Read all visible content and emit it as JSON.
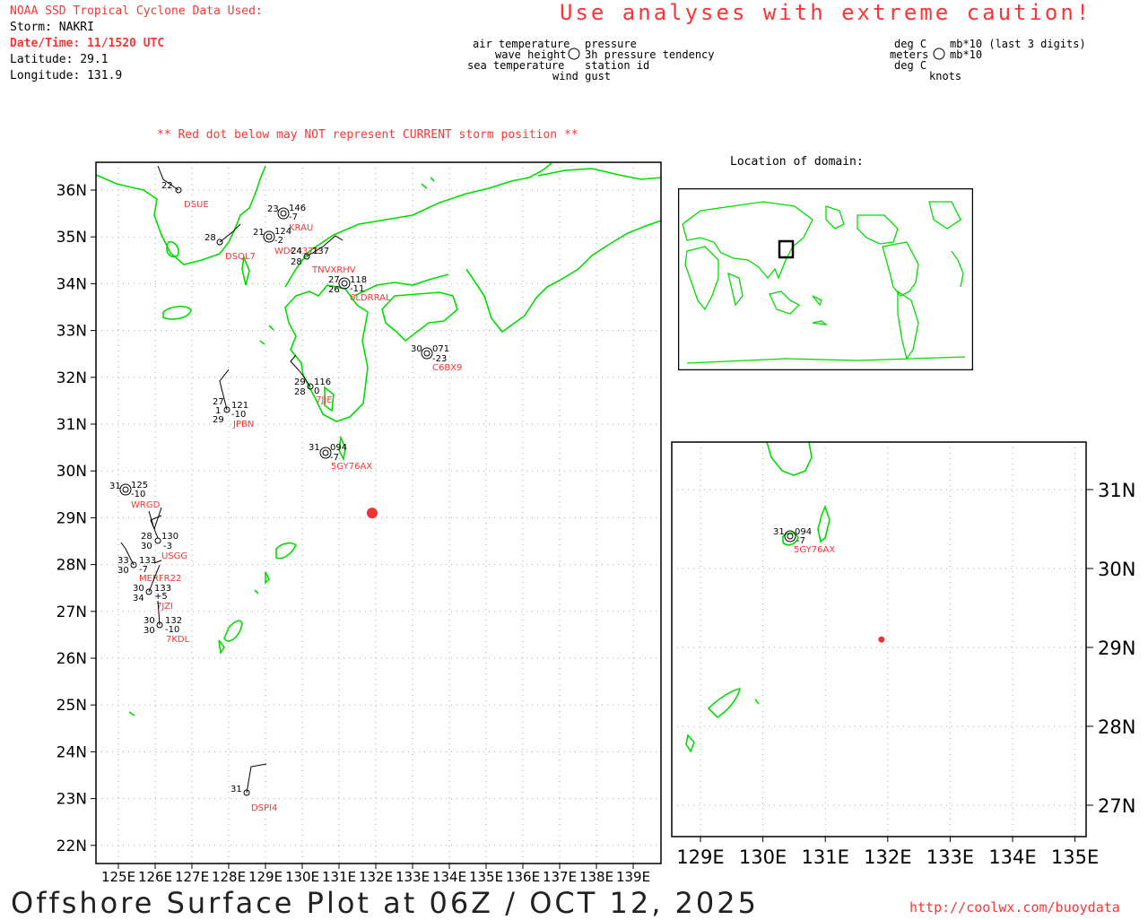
{
  "header": {
    "source_title": "NOAA SSD Tropical Cyclone Data Used:",
    "storm": "Storm: NAKRI",
    "datetime": "Date/Time: 11/1520 UTC",
    "latitude": "Latitude: 29.1",
    "longitude": "Longitude: 131.9"
  },
  "caution": "Use analyses with extreme caution!",
  "legend": {
    "left": {
      "air_temperature": "air temperature",
      "pressure": "pressure",
      "wave_height": "wave height",
      "pressure_tendency": "3h pressure tendency",
      "sea_temperature": "sea temperature",
      "station_id": "station id",
      "wind_gust": "wind gust"
    },
    "right": {
      "deg_c_top": "deg C",
      "mb_top": "mb*10 (last 3 digits)",
      "meters": "meters",
      "mb_bottom": "mb*10",
      "deg_c_bottom": "deg C",
      "knots": "knots"
    }
  },
  "warning": "** Red dot below may NOT represent CURRENT storm position **",
  "location_title": "Location of domain:",
  "main_map": {
    "lon_labels": [
      "125E",
      "126E",
      "127E",
      "128E",
      "129E",
      "130E",
      "131E",
      "132E",
      "133E",
      "134E",
      "135E",
      "136E",
      "137E",
      "138E",
      "139E"
    ],
    "lat_labels": [
      "36N",
      "35N",
      "34N",
      "33N",
      "32N",
      "31N",
      "30N",
      "29N",
      "28N",
      "27N",
      "26N",
      "25N",
      "24N",
      "23N",
      "22N"
    ],
    "storm": {
      "lon": 131.9,
      "lat": 29.1
    }
  },
  "stations": [
    {
      "id": "DSUE",
      "lines": [
        "22"
      ]
    },
    {
      "id": "KRAU",
      "lines": [
        "23",
        "146",
        "-7"
      ]
    },
    {
      "id": "DSQL7",
      "lines": [
        "28"
      ]
    },
    {
      "id": "WDC4371",
      "lines": [
        "21",
        "124",
        "-2"
      ]
    },
    {
      "id": "TNVXRHV",
      "lines": [
        "24",
        "137",
        "28"
      ]
    },
    {
      "id": "6LDRRAL",
      "lines": [
        "27",
        "118",
        "26",
        "-11"
      ]
    },
    {
      "id": "C6BX9",
      "lines": [
        "30",
        "071",
        "-23"
      ]
    },
    {
      "id": "7JJE",
      "lines": [
        "29",
        "116",
        "28",
        "0"
      ]
    },
    {
      "id": "JPBN",
      "lines": [
        "27",
        "121",
        "1",
        "-10",
        "29"
      ]
    },
    {
      "id": "5GY76AX",
      "lines": [
        "31",
        "094",
        "-7"
      ]
    },
    {
      "id": "WRGD",
      "lines": [
        "31",
        "125",
        "-10"
      ]
    },
    {
      "id": "USGG",
      "lines": [
        "28",
        "130",
        "30",
        "-3"
      ]
    },
    {
      "id": "MERFR22",
      "lines": [
        "33",
        "133",
        "30",
        "-7"
      ]
    },
    {
      "id": "7JZI",
      "lines": [
        "30",
        "133",
        "34",
        "+5"
      ]
    },
    {
      "id": "7KDL",
      "lines": [
        "30",
        "132",
        "30",
        "-10"
      ]
    },
    {
      "id": "DSPI4",
      "lines": [
        "31"
      ]
    }
  ],
  "zoom_map": {
    "lon_labels": [
      "129E",
      "130E",
      "131E",
      "132E",
      "133E",
      "134E",
      "135E"
    ],
    "lat_labels": [
      "31N",
      "30N",
      "29N",
      "28N",
      "27N"
    ],
    "station": {
      "id": "5GY76AX",
      "lines": [
        "31",
        "094",
        "-7"
      ]
    }
  },
  "footer": {
    "title": "Offshore Surface Plot at 06Z / OCT 12, 2025",
    "url": "http://coolwx.com/buoydata"
  },
  "colors": {
    "coast": "#00dd00",
    "accent": "#ff3333",
    "grid": "#999999",
    "frame": "#000000"
  }
}
